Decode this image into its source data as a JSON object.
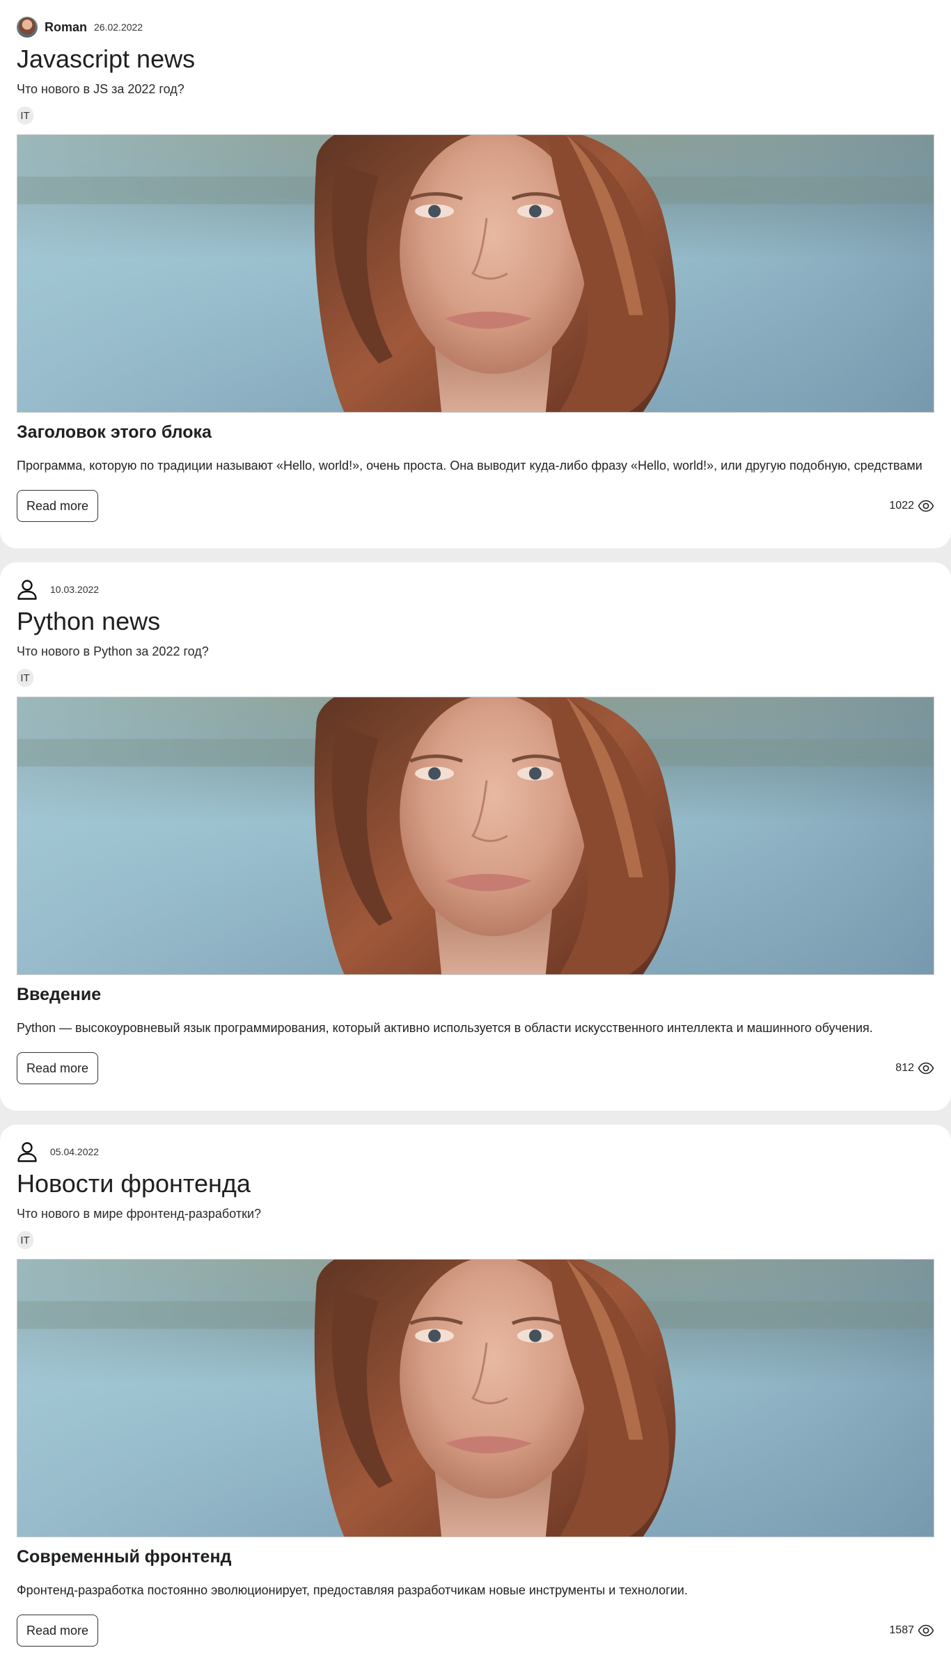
{
  "posts": [
    {
      "author": "Roman",
      "date": "26.02.2022",
      "title": "Javascript news",
      "subtitle": "Что нового в JS за 2022 год?",
      "tag": "IT",
      "block_title": "Заголовок этого блока",
      "block_text": "Программа, которую по традиции называют «Hello, world!», очень проста. Она выводит куда-либо фразу «Hello, world!», или другую подобную, средствами некоего языка.",
      "read_more": "Read more",
      "views": "1022"
    },
    {
      "author": "",
      "date": "10.03.2022",
      "title": "Python news",
      "subtitle": "Что нового в Python за 2022 год?",
      "tag": "IT",
      "block_title": "Введение",
      "block_text": "Python — высокоуровневый язык программирования, который активно используется в области искусственного интеллекта и машинного обучения.",
      "read_more": "Read more",
      "views": "812"
    },
    {
      "author": "",
      "date": "05.04.2022",
      "title": "Новости фронтенда",
      "subtitle": "Что нового в мире фронтенд-разработки?",
      "tag": "IT",
      "block_title": "Современный фронтенд",
      "block_text": "Фронтенд-разработка постоянно эволюционирует, предоставляя разработчикам новые инструменты и технологии.",
      "read_more": "Read more",
      "views": "1587"
    }
  ],
  "icons": {
    "avatar": "avatar-photo",
    "user": "user-icon",
    "views": "eye-icon"
  }
}
